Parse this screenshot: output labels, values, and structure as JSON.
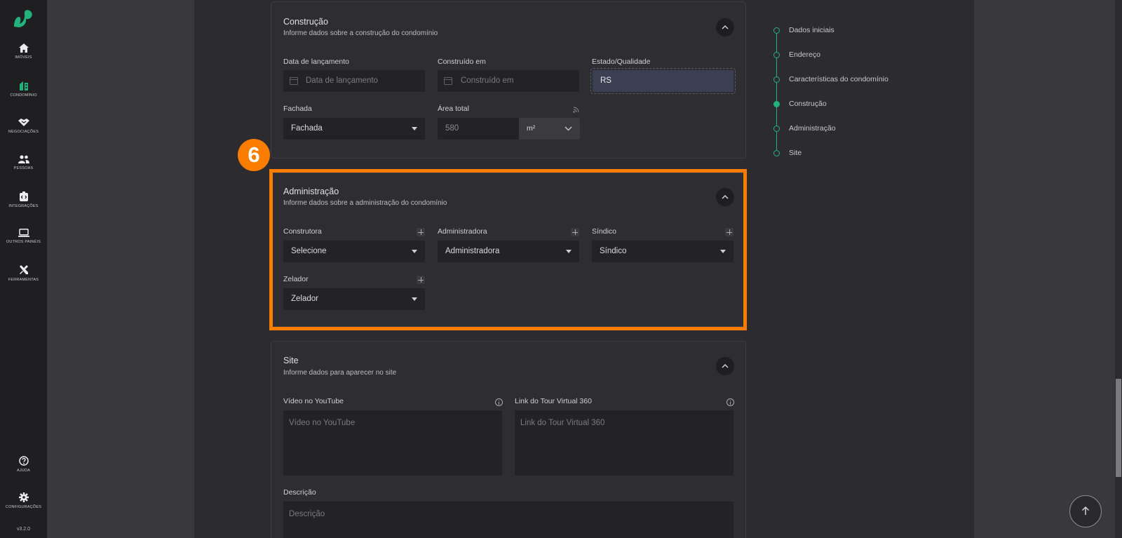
{
  "sidebar": {
    "items": [
      {
        "label": "Imóveis",
        "icon": "home-icon"
      },
      {
        "label": "Condomínio",
        "icon": "building-icon"
      },
      {
        "label": "Negociações",
        "icon": "handshake-icon"
      },
      {
        "label": "Pessoas",
        "icon": "people-icon"
      },
      {
        "label": "Integrações",
        "icon": "integration-icon"
      },
      {
        "label": "Outros Painéis",
        "icon": "laptop-icon"
      },
      {
        "label": "Ferramentas",
        "icon": "tools-icon"
      }
    ],
    "bottom": [
      {
        "label": "Ajuda",
        "icon": "help-icon"
      },
      {
        "label": "Configurações",
        "icon": "gear-icon"
      }
    ],
    "version": "v3.2.0",
    "accent": "#21b37b"
  },
  "construcao": {
    "title": "Construção",
    "subtitle": "Informe dados sobre a construção do condomínio",
    "lancamento": {
      "label": "Data de lançamento",
      "placeholder": "Data de lançamento"
    },
    "construido": {
      "label": "Construído em",
      "placeholder": "Construído em"
    },
    "estado": {
      "label": "Estado/Qualidade",
      "value": "RS"
    },
    "fachada": {
      "label": "Fachada",
      "value": "Fachada"
    },
    "area": {
      "label": "Área total",
      "value": "580",
      "unit": "m²"
    }
  },
  "administracao": {
    "step_number": "6",
    "title": "Administração",
    "subtitle": "Informe dados sobre a administração do condomínio",
    "construtora": {
      "label": "Construtora",
      "value": "Selecione"
    },
    "administradora": {
      "label": "Administradora",
      "value": "Administradora"
    },
    "sindico": {
      "label": "Síndico",
      "value": "Síndico"
    },
    "zelador": {
      "label": "Zelador",
      "value": "Zelador"
    },
    "highlight_color": "#fb7d00"
  },
  "site": {
    "title": "Site",
    "subtitle": "Informe dados para aparecer no site",
    "youtube": {
      "label": "Vídeo no YouTube",
      "placeholder": "Vídeo no YouTube"
    },
    "tour": {
      "label": "Link do Tour Virtual 360",
      "placeholder": "Link do Tour Virtual 360"
    },
    "descricao": {
      "label": "Descrição",
      "placeholder": "Descrição"
    }
  },
  "stepper": {
    "items": [
      "Dados iniciais",
      "Endereço",
      "Características do condomínio",
      "Construção",
      "Administração",
      "Site"
    ],
    "active": "Construção"
  }
}
